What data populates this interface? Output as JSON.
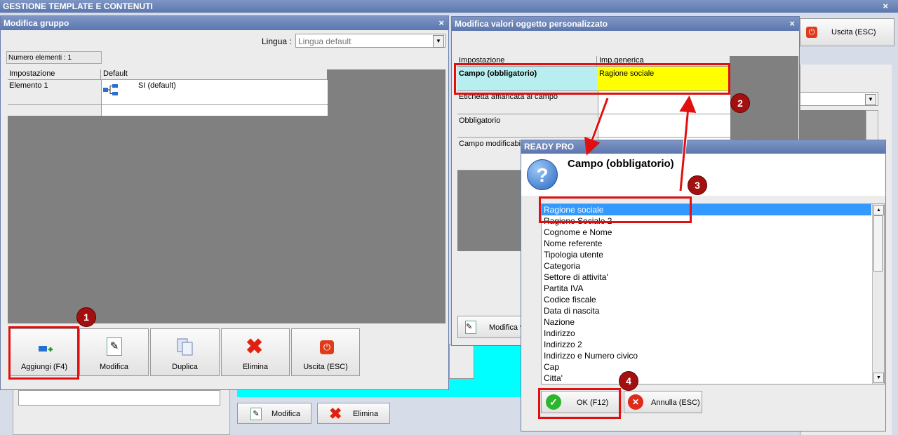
{
  "app": {
    "title": "GESTIONE TEMPLATE E CONTENUTI",
    "exit_label": "Uscita (ESC)",
    "bg_edit_label": "Modifica",
    "bg_delete_label": "Elimina"
  },
  "group_window": {
    "title": "Modifica gruppo",
    "language_label": "Lingua :",
    "language_value": "Lingua default",
    "count_label": "Numero elementi : 1",
    "columns": [
      "Impostazione",
      "Default"
    ],
    "rows": [
      {
        "setting": "Elemento 1",
        "default": "SI (default)"
      }
    ],
    "buttons": {
      "add": "Aggiungi (F4)",
      "edit": "Modifica",
      "duplicate": "Duplica",
      "delete": "Elimina",
      "exit": "Uscita (ESC)"
    }
  },
  "custom_window": {
    "title": "Modifica valori oggetto personalizzato",
    "columns": [
      "Impostazione",
      "Imp.generica"
    ],
    "rows": [
      {
        "setting": "Campo (obbligatorio)",
        "value": "Ragione sociale"
      },
      {
        "setting": "Etichetta affiancata al campo",
        "value": ""
      },
      {
        "setting": "Obbligatorio",
        "value": ""
      },
      {
        "setting": "Campo modificabile",
        "value": ""
      }
    ],
    "edit_button": "Modifica v"
  },
  "dialog": {
    "title": "READY PRO",
    "question": "Campo (obbligatorio)",
    "options": [
      "Ragione sociale",
      "Ragione Sociale 2",
      "Cognome e Nome",
      "Nome referente",
      "Tipologia utente",
      "Categoria",
      "Settore di attivita'",
      "Partita IVA",
      "Codice fiscale",
      "Data di nascita",
      "Nazione",
      "Indirizzo",
      "Indirizzo 2",
      "Indirizzo e Numero civico",
      "Cap",
      "Citta'"
    ],
    "selected": "Ragione sociale",
    "ok_label": "OK (F12)",
    "cancel_label": "Annulla (ESC)"
  },
  "badges": [
    "1",
    "2",
    "3",
    "4"
  ],
  "colors": {
    "selected": "#3399ff",
    "highlight_row": "#b8eef0",
    "highlight_value": "#ffff00",
    "annotation": "#e01010",
    "cyan_area": "#00ffff"
  }
}
